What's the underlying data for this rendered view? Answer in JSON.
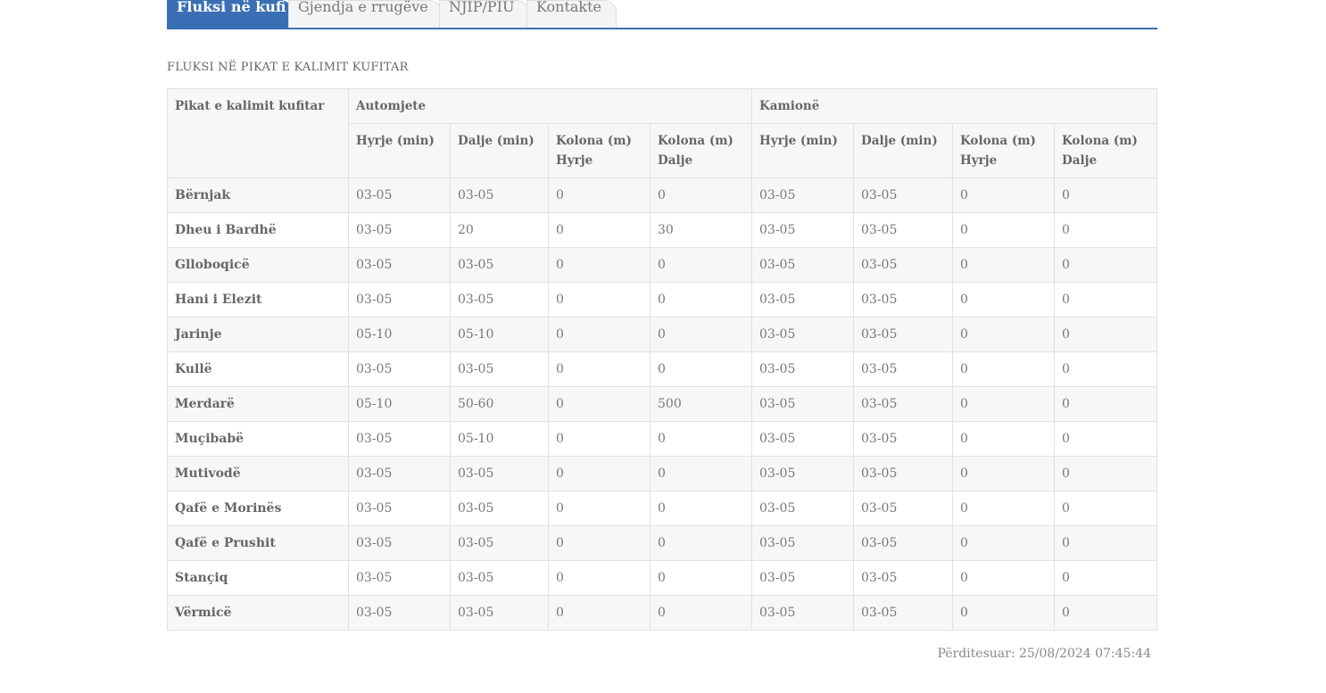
{
  "tabs": [
    {
      "label": "Fluksi në kufi",
      "active": true
    },
    {
      "label": "Gjendja e rrugëve",
      "active": false
    },
    {
      "label": "NJIP/PIU",
      "active": false
    },
    {
      "label": "Kontakte",
      "active": false
    }
  ],
  "section_title": "FLUKSI NË PIKAT E KALIMIT KUFITAR",
  "table": {
    "col_point": "Pikat e kalimit kufitar",
    "group_cars": "Automjete",
    "group_trucks": "Kamionë",
    "sub_headers": [
      "Hyrje (min)",
      "Dalje (min)",
      "Kolona (m) Hyrje",
      "Kolona (m) Dalje",
      "Hyrje (min)",
      "Dalje (min)",
      "Kolona (m) Hyrje",
      "Kolona (m) Dalje"
    ],
    "rows": [
      {
        "name": "Bërnjak",
        "values": [
          "03-05",
          "03-05",
          "0",
          "0",
          "03-05",
          "03-05",
          "0",
          "0"
        ]
      },
      {
        "name": "Dheu i Bardhë",
        "values": [
          "03-05",
          "20",
          "0",
          "30",
          "03-05",
          "03-05",
          "0",
          "0"
        ]
      },
      {
        "name": "Glloboqicë",
        "values": [
          "03-05",
          "03-05",
          "0",
          "0",
          "03-05",
          "03-05",
          "0",
          "0"
        ]
      },
      {
        "name": "Hani i Elezit",
        "values": [
          "03-05",
          "03-05",
          "0",
          "0",
          "03-05",
          "03-05",
          "0",
          "0"
        ]
      },
      {
        "name": "Jarinje",
        "values": [
          "05-10",
          "05-10",
          "0",
          "0",
          "03-05",
          "03-05",
          "0",
          "0"
        ]
      },
      {
        "name": "Kullë",
        "values": [
          "03-05",
          "03-05",
          "0",
          "0",
          "03-05",
          "03-05",
          "0",
          "0"
        ]
      },
      {
        "name": "Merdarë",
        "values": [
          "05-10",
          "50-60",
          "0",
          "500",
          "03-05",
          "03-05",
          "0",
          "0"
        ]
      },
      {
        "name": "Muçibabë",
        "values": [
          "03-05",
          "05-10",
          "0",
          "0",
          "03-05",
          "03-05",
          "0",
          "0"
        ]
      },
      {
        "name": "Mutivodë",
        "values": [
          "03-05",
          "03-05",
          "0",
          "0",
          "03-05",
          "03-05",
          "0",
          "0"
        ]
      },
      {
        "name": "Qafë e Morinës",
        "values": [
          "03-05",
          "03-05",
          "0",
          "0",
          "03-05",
          "03-05",
          "0",
          "0"
        ]
      },
      {
        "name": "Qafë e Prushit",
        "values": [
          "03-05",
          "03-05",
          "0",
          "0",
          "03-05",
          "03-05",
          "0",
          "0"
        ]
      },
      {
        "name": "Stançiq",
        "values": [
          "03-05",
          "03-05",
          "0",
          "0",
          "03-05",
          "03-05",
          "0",
          "0"
        ]
      },
      {
        "name": "Vërmicë",
        "values": [
          "03-05",
          "03-05",
          "0",
          "0",
          "03-05",
          "03-05",
          "0",
          "0"
        ]
      }
    ]
  },
  "updated": "Përditesuar: 25/08/2024 07:45:44",
  "colors": {
    "accent": "#3a6fb5"
  }
}
